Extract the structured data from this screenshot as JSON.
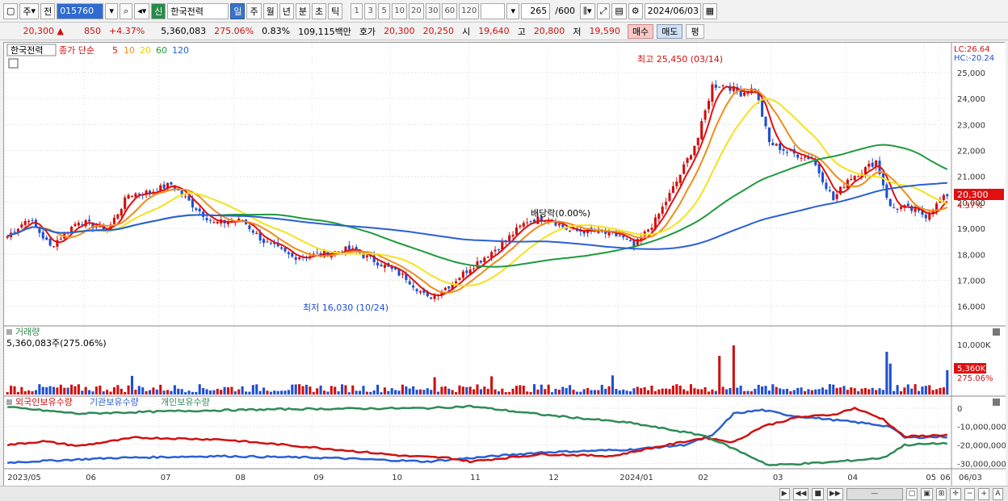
{
  "toolbar": {
    "period_label": "주",
    "prev_label": "전",
    "stock_code": "015760",
    "stock_type": "신",
    "stock_name": "한국전력",
    "tabs": [
      "일",
      "주",
      "월",
      "년",
      "분",
      "초",
      "틱"
    ],
    "active_tab": "일",
    "intervals": [
      "1",
      "3",
      "5",
      "10",
      "20",
      "30",
      "60",
      "120"
    ],
    "count": "265",
    "count_total": "/600",
    "date": "2024/06/03"
  },
  "quote": {
    "price": "20,300",
    "change_arrow": "▲",
    "change": "850",
    "change_pct": "+4.37%",
    "volume": "5,360,083",
    "volume_ratio": "275.06%",
    "turnover": "0.83%",
    "amount": "109,115백만",
    "ask_label": "호가",
    "ask": "20,300",
    "bid": "20,250",
    "open_label": "시",
    "open": "19,640",
    "high_label": "고",
    "high": "20,800",
    "low_label": "저",
    "low": "19,590",
    "buy_button": "매수",
    "sell_button": "매도",
    "eval_button": "평"
  },
  "legend": {
    "name": "한국전력",
    "series_label": "종가 단순",
    "ma_periods": [
      "5",
      "10",
      "20",
      "60",
      "120"
    ],
    "lc": "LC:26.64",
    "hc": "HC:-20.24"
  },
  "annotations": {
    "high": "최고 25,450 (03/14)",
    "low": "최저 16,030 (10/24)",
    "dividend": "배당락(0.00%)",
    "price_tag": "20,300",
    "pct_tag": "4.37%",
    "vol_title": "거래량",
    "vol_value": "5,360,083주(275.06%)",
    "vol_tag": "5,360K",
    "vol_pct_tag": "275.06%",
    "flow_foreign": "외국인보유수량",
    "flow_inst": "기관보유수량",
    "flow_indiv": "개인보유수량"
  },
  "colors": {
    "up": "#d01010",
    "down": "#1f4fd0",
    "ma5": "#e01010",
    "ma10": "#f08c1a",
    "ma20": "#f5e21a",
    "ma60": "#1e9a3c",
    "ma120": "#2a5fd6",
    "foreign": "#2a5fd6",
    "inst": "#d01010",
    "indiv": "#2e8b57"
  },
  "chart_data": {
    "type": "candlestick",
    "price_axis": {
      "ticks": [
        "16,000",
        "17,000",
        "18,000",
        "19,000",
        "20,000",
        "21,000",
        "22,000",
        "23,000",
        "24,000",
        "25,000"
      ],
      "ylim": [
        15400,
        25900
      ]
    },
    "volume_axis": {
      "ticks": [
        "10,000K"
      ]
    },
    "flow_axis": {
      "ticks": [
        "0",
        "-10,000,000",
        "-20,000,000",
        "-30,000,000"
      ],
      "ylim": [
        -32000000,
        3000000
      ]
    },
    "x_ticks": [
      "2023/05",
      "06",
      "07",
      "08",
      "09",
      "10",
      "11",
      "12",
      "2024/01",
      "02",
      "03",
      "04",
      "05",
      "06",
      "06/03"
    ],
    "close_anchors": [
      {
        "i": 0,
        "v": 18700
      },
      {
        "i": 6,
        "v": 19400
      },
      {
        "i": 12,
        "v": 18300
      },
      {
        "i": 20,
        "v": 19300
      },
      {
        "i": 28,
        "v": 18900
      },
      {
        "i": 34,
        "v": 20300
      },
      {
        "i": 40,
        "v": 20400
      },
      {
        "i": 46,
        "v": 20700
      },
      {
        "i": 52,
        "v": 19900
      },
      {
        "i": 58,
        "v": 19200
      },
      {
        "i": 66,
        "v": 19300
      },
      {
        "i": 72,
        "v": 18500
      },
      {
        "i": 80,
        "v": 17900
      },
      {
        "i": 88,
        "v": 18000
      },
      {
        "i": 96,
        "v": 18200
      },
      {
        "i": 104,
        "v": 17700
      },
      {
        "i": 112,
        "v": 17100
      },
      {
        "i": 118,
        "v": 16300
      },
      {
        "i": 124,
        "v": 16800
      },
      {
        "i": 130,
        "v": 17500
      },
      {
        "i": 138,
        "v": 18300
      },
      {
        "i": 146,
        "v": 19300
      },
      {
        "i": 152,
        "v": 19400
      },
      {
        "i": 158,
        "v": 18900
      },
      {
        "i": 164,
        "v": 18900
      },
      {
        "i": 172,
        "v": 18700
      },
      {
        "i": 176,
        "v": 18300
      },
      {
        "i": 182,
        "v": 19300
      },
      {
        "i": 188,
        "v": 20800
      },
      {
        "i": 194,
        "v": 22500
      },
      {
        "i": 198,
        "v": 24500
      },
      {
        "i": 202,
        "v": 24500
      },
      {
        "i": 206,
        "v": 24200
      },
      {
        "i": 210,
        "v": 24400
      },
      {
        "i": 214,
        "v": 22300
      },
      {
        "i": 220,
        "v": 21900
      },
      {
        "i": 226,
        "v": 21700
      },
      {
        "i": 232,
        "v": 20100
      },
      {
        "i": 236,
        "v": 20900
      },
      {
        "i": 240,
        "v": 21200
      },
      {
        "i": 244,
        "v": 21600
      },
      {
        "i": 248,
        "v": 19800
      },
      {
        "i": 252,
        "v": 19800
      },
      {
        "i": 258,
        "v": 19500
      },
      {
        "i": 264,
        "v": 20300
      }
    ],
    "volume_spikes": [
      {
        "i": 200,
        "v": 8500
      },
      {
        "i": 204,
        "v": 10800
      },
      {
        "i": 247,
        "v": 9400
      },
      {
        "i": 248,
        "v": 6800
      },
      {
        "i": 264,
        "v": 5360
      },
      {
        "i": 120,
        "v": 3800
      },
      {
        "i": 136,
        "v": 4000
      },
      {
        "i": 170,
        "v": 4200
      },
      {
        "i": 35,
        "v": 4100
      }
    ],
    "flow_foreign": [
      {
        "i": 0,
        "v": -29500000
      },
      {
        "i": 30,
        "v": -27000000
      },
      {
        "i": 60,
        "v": -26000000
      },
      {
        "i": 90,
        "v": -27000000
      },
      {
        "i": 118,
        "v": -29000000
      },
      {
        "i": 124,
        "v": -28000000
      },
      {
        "i": 150,
        "v": -24000000
      },
      {
        "i": 175,
        "v": -22500000
      },
      {
        "i": 190,
        "v": -20000000
      },
      {
        "i": 198,
        "v": -15000000
      },
      {
        "i": 204,
        "v": -3000000
      },
      {
        "i": 212,
        "v": -1000000
      },
      {
        "i": 220,
        "v": -4000000
      },
      {
        "i": 230,
        "v": -6000000
      },
      {
        "i": 240,
        "v": -8000000
      },
      {
        "i": 248,
        "v": -10000000
      },
      {
        "i": 252,
        "v": -16000000
      },
      {
        "i": 264,
        "v": -15500000
      }
    ],
    "flow_inst": [
      {
        "i": 0,
        "v": -20000000
      },
      {
        "i": 10,
        "v": -18000000
      },
      {
        "i": 20,
        "v": -20500000
      },
      {
        "i": 36,
        "v": -16000000
      },
      {
        "i": 60,
        "v": -17000000
      },
      {
        "i": 90,
        "v": -22000000
      },
      {
        "i": 112,
        "v": -26000000
      },
      {
        "i": 124,
        "v": -27000000
      },
      {
        "i": 130,
        "v": -29000000
      },
      {
        "i": 150,
        "v": -25000000
      },
      {
        "i": 170,
        "v": -26000000
      },
      {
        "i": 180,
        "v": -22000000
      },
      {
        "i": 196,
        "v": -16000000
      },
      {
        "i": 204,
        "v": -18500000
      },
      {
        "i": 212,
        "v": -10000000
      },
      {
        "i": 222,
        "v": -5000000
      },
      {
        "i": 232,
        "v": -3500000
      },
      {
        "i": 238,
        "v": 0
      },
      {
        "i": 246,
        "v": -6000000
      },
      {
        "i": 252,
        "v": -15500000
      },
      {
        "i": 264,
        "v": -14500000
      }
    ],
    "flow_indiv": [
      {
        "i": 0,
        "v": 500000
      },
      {
        "i": 20,
        "v": -3000000
      },
      {
        "i": 50,
        "v": -1500000
      },
      {
        "i": 80,
        "v": -500000
      },
      {
        "i": 118,
        "v": 0
      },
      {
        "i": 130,
        "v": 1000000
      },
      {
        "i": 150,
        "v": -3500000
      },
      {
        "i": 175,
        "v": -8000000
      },
      {
        "i": 196,
        "v": -15000000
      },
      {
        "i": 204,
        "v": -22000000
      },
      {
        "i": 214,
        "v": -31000000
      },
      {
        "i": 230,
        "v": -29500000
      },
      {
        "i": 246,
        "v": -27000000
      },
      {
        "i": 252,
        "v": -20000000
      },
      {
        "i": 264,
        "v": -19000000
      }
    ]
  }
}
